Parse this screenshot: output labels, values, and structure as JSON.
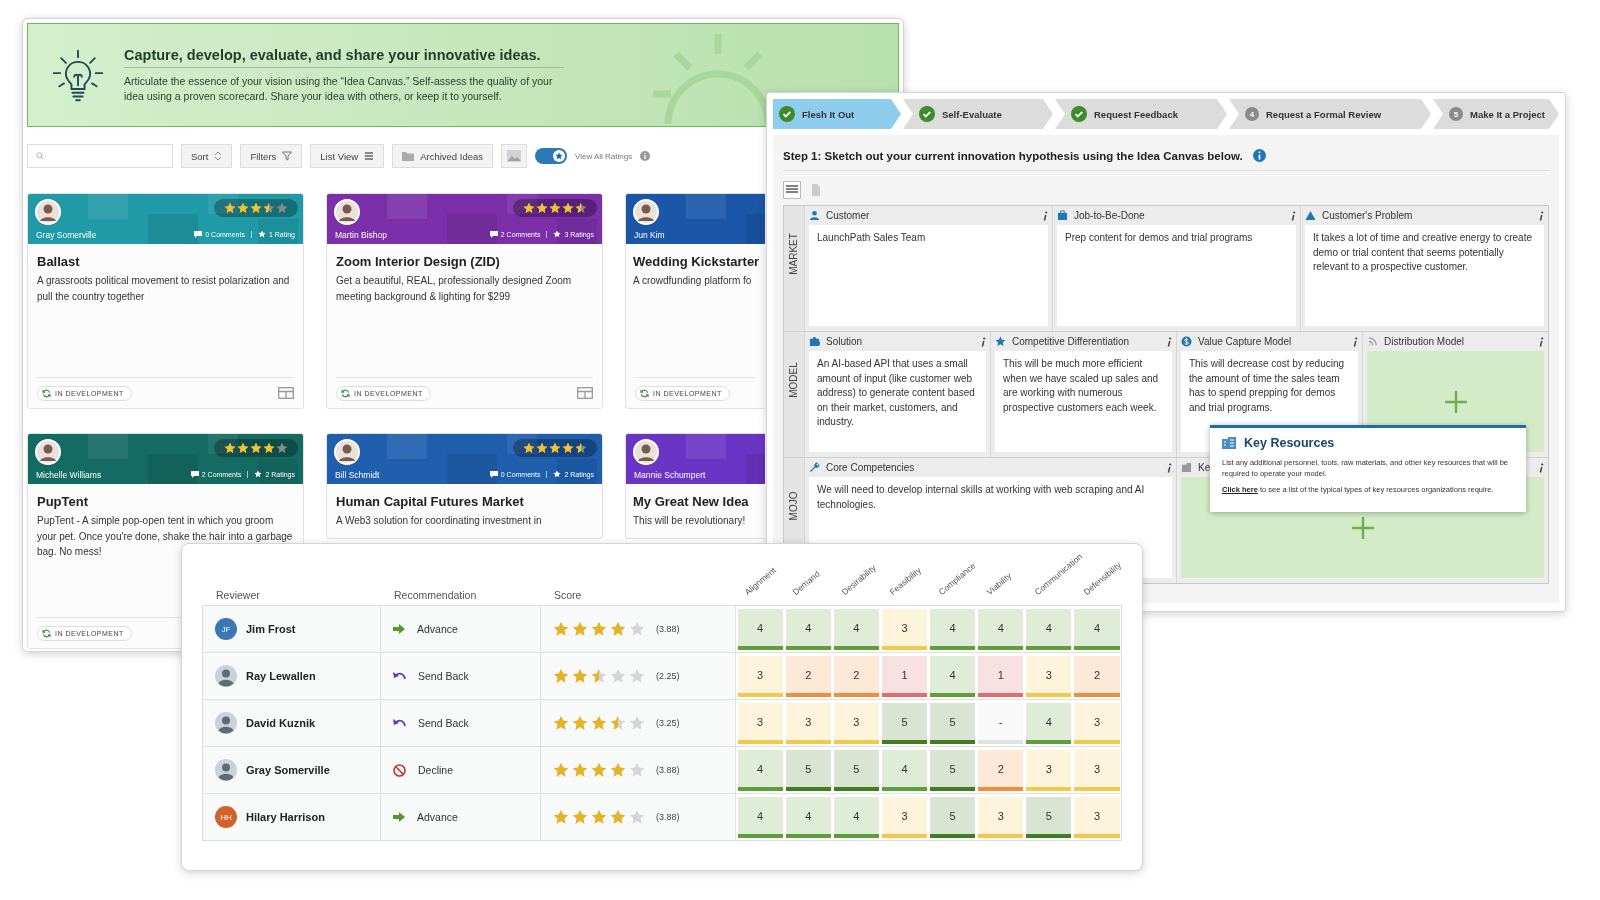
{
  "ideas_window": {
    "banner": {
      "title": "Capture, develop, evaluate, and share your innovative ideas.",
      "description": "Articulate the essence of your vision using the “Idea Canvas.” Self-assess the quality of your idea using a proven scorecard. Share your idea with others, or keep it to yourself."
    },
    "toolbar": {
      "buttons": [
        {
          "kind": "sort",
          "label": "Sort"
        },
        {
          "kind": "filter",
          "label": "Filters"
        },
        {
          "kind": "list",
          "label": "List View"
        },
        {
          "kind": "folder",
          "label": "Archived Ideas"
        }
      ],
      "toggle": {
        "on": true,
        "label": "View All Ratings"
      }
    },
    "ideas": [
      {
        "author": "Gray Somerville",
        "color": "#1f9aa6",
        "stars": 3.5,
        "comments": "0 Comments",
        "ratings": "1 Rating",
        "view_toggle": true,
        "title": "Ballast",
        "description": "A grassroots political movement to resist polarization and pull the country together",
        "status": "IN DEVELOPMENT"
      },
      {
        "author": "Martin Bishop",
        "color": "#7b2fa8",
        "stars": 4.5,
        "comments": "2 Comments",
        "ratings": "3 Ratings",
        "view_toggle": true,
        "title": "Zoom Interior Design (ZID)",
        "description": "Get a beautiful, REAL, professionally designed Zoom meeting background & lighting for $299",
        "status": "IN DEVELOPMENT"
      },
      {
        "author": "Jun Kim",
        "color": "#1b56a8",
        "title": "Wedding Kickstarter",
        "description": "A crowdfunding platform fo",
        "status": "IN DEVELOPMENT"
      },
      {
        "author": "Michelle Williams",
        "color": "#146b63",
        "stars": 4,
        "comments": "2 Comments",
        "ratings": "2 Ratings",
        "title": "PupTent",
        "description": "PupTent - A simple pop-open tent in which you groom your pet. Once you're done, shake the hair into a garbage bag. No mess!",
        "status": "IN DEVELOPMENT"
      },
      {
        "author": "Bill Schmidt",
        "color": "#1f5fae",
        "stars": 4.5,
        "comments": "0 Comments",
        "ratings": "2 Ratings",
        "title": "Human Capital Futures Market",
        "description": "A Web3 solution for coordinating investment in"
      },
      {
        "author": "Mannie Schumpert",
        "color": "#6a35c4",
        "title": "My Great New Idea",
        "description": "This will be revolutionary!"
      }
    ]
  },
  "canvas_window": {
    "steps": [
      {
        "label": "Flesh It Out",
        "done": true,
        "selected": true
      },
      {
        "label": "Self-Evaluate",
        "done": true,
        "selected": false
      },
      {
        "label": "Request Feedback",
        "done": true,
        "selected": false
      },
      {
        "label": "Request a Formal Review",
        "number": "4",
        "done": false,
        "selected": false
      },
      {
        "label": "Make It a Project",
        "number": "5",
        "done": false,
        "selected": false
      }
    ],
    "instruction": "Step 1: Sketch out your current innovation hypothesis using the Idea Canvas below.",
    "rows": [
      {
        "label": "MARKET",
        "cells": [
          {
            "kind": "text",
            "title": "Customer",
            "text": "LaunchPath Sales Team"
          },
          {
            "kind": "text",
            "title": "Job-to-Be-Done",
            "text": "Prep content for demos and trial programs"
          },
          {
            "kind": "text",
            "title": "Customer's Problem",
            "text": "It takes a lot of time and creative energy to create demo or trial content that seems potentially relevant to a prospective customer."
          }
        ]
      },
      {
        "label": "MODEL",
        "cells": [
          {
            "kind": "text",
            "title": "Solution",
            "text": "An AI-based API that uses a small amount of input (like customer web address) to generate content based on their market, customers, and industry."
          },
          {
            "kind": "text",
            "title": "Competitive Differentiation",
            "text": "This will be much more efficient when we have scaled up sales and are working with numerous prospective customers each week."
          },
          {
            "kind": "text",
            "title": "Value Capture Model",
            "text": "This will decrease cost by reducing the amount of time the sales team has to spend prepping for demos and trial programs."
          },
          {
            "kind": "empty",
            "title": "Distribution Model"
          }
        ]
      },
      {
        "label": "MOJO",
        "cells": [
          {
            "kind": "text",
            "title": "Core Competencies",
            "text": "We will need to develop internal skills at working with web scraping and AI technologies."
          },
          {
            "kind": "empty",
            "title": "Ke"
          }
        ]
      }
    ],
    "tooltip": {
      "title": "Key Resources",
      "text": "List any additional personnel, tools, raw materials, and other key resources that will be required to operate your model.",
      "link": "Click here",
      "link_rest": " to see a list of the typical types of key resources organizations require."
    }
  },
  "scores_window": {
    "columns": [
      "Reviewer",
      "Recommendation",
      "Score"
    ],
    "criteria": [
      "Alignment",
      "Demand",
      "Desirability",
      "Feasibility",
      "Compliance",
      "Viability",
      "Communication",
      "Defensibility"
    ],
    "rows": [
      {
        "reviewer": "Jim Frost",
        "avatar": {
          "kind": "initials",
          "initials": "JF",
          "color": "#3a78b5"
        },
        "recommendation": {
          "kind": "advance",
          "label": "Advance"
        },
        "stars": 4,
        "score": "(3.88)",
        "scores": [
          {
            "value": "4",
            "color": "#5f9e3a"
          },
          {
            "value": "4",
            "color": "#5f9e3a"
          },
          {
            "value": "4",
            "color": "#5f9e3a"
          },
          {
            "value": "3",
            "color": "#f2c94c"
          },
          {
            "value": "4",
            "color": "#5f9e3a"
          },
          {
            "value": "4",
            "color": "#5f9e3a"
          },
          {
            "value": "4",
            "color": "#5f9e3a"
          },
          {
            "value": "4",
            "color": "#5f9e3a"
          }
        ]
      },
      {
        "reviewer": "Ray Lewallen",
        "avatar": {
          "kind": "photo"
        },
        "recommendation": {
          "kind": "send_back",
          "label": "Send Back"
        },
        "stars": 2.5,
        "score": "(2.25)",
        "scores": [
          {
            "value": "3",
            "color": "#f2c94c"
          },
          {
            "value": "2",
            "color": "#ef8f3a"
          },
          {
            "value": "2",
            "color": "#ef8f3a"
          },
          {
            "value": "1",
            "color": "#e56b6b"
          },
          {
            "value": "4",
            "color": "#5f9e3a"
          },
          {
            "value": "1",
            "color": "#e56b6b"
          },
          {
            "value": "3",
            "color": "#f2c94c"
          },
          {
            "value": "2",
            "color": "#ef8f3a"
          }
        ]
      },
      {
        "reviewer": "David Kuznik",
        "avatar": {
          "kind": "photo"
        },
        "recommendation": {
          "kind": "send_back",
          "label": "Send Back"
        },
        "stars": 3.5,
        "score": "(3.25)",
        "scores": [
          {
            "value": "3",
            "color": "#f2c94c"
          },
          {
            "value": "3",
            "color": "#f2c94c"
          },
          {
            "value": "3",
            "color": "#f2c94c"
          },
          {
            "value": "5",
            "color": "#3f7d20"
          },
          {
            "value": "5",
            "color": "#3f7d20"
          },
          {
            "value": "-",
            "color": "#e2e2e2"
          },
          {
            "value": "4",
            "color": "#5f9e3a"
          },
          {
            "value": "3",
            "color": "#f2c94c"
          }
        ]
      },
      {
        "reviewer": "Gray Somerville",
        "avatar": {
          "kind": "photo"
        },
        "recommendation": {
          "kind": "decline",
          "label": "Decline"
        },
        "stars": 4,
        "score": "(3.88)",
        "scores": [
          {
            "value": "4",
            "color": "#5f9e3a"
          },
          {
            "value": "5",
            "color": "#3f7d20"
          },
          {
            "value": "5",
            "color": "#3f7d20"
          },
          {
            "value": "4",
            "color": "#5f9e3a"
          },
          {
            "value": "5",
            "color": "#3f7d20"
          },
          {
            "value": "2",
            "color": "#ef8f3a"
          },
          {
            "value": "3",
            "color": "#f2c94c"
          },
          {
            "value": "3",
            "color": "#f2c94c"
          }
        ]
      },
      {
        "reviewer": "Hilary Harrison",
        "avatar": {
          "kind": "initials",
          "initials": "HH",
          "color": "#d0632a"
        },
        "recommendation": {
          "kind": "advance",
          "label": "Advance"
        },
        "stars": 4,
        "score": "(3.88)",
        "scores": [
          {
            "value": "4",
            "color": "#5f9e3a"
          },
          {
            "value": "4",
            "color": "#5f9e3a"
          },
          {
            "value": "4",
            "color": "#5f9e3a"
          },
          {
            "value": "3",
            "color": "#f2c94c"
          },
          {
            "value": "5",
            "color": "#3f7d20"
          },
          {
            "value": "3",
            "color": "#f2c94c"
          },
          {
            "value": "5",
            "color": "#3f7d20"
          },
          {
            "value": "3",
            "color": "#f2c94c"
          }
        ]
      }
    ]
  }
}
